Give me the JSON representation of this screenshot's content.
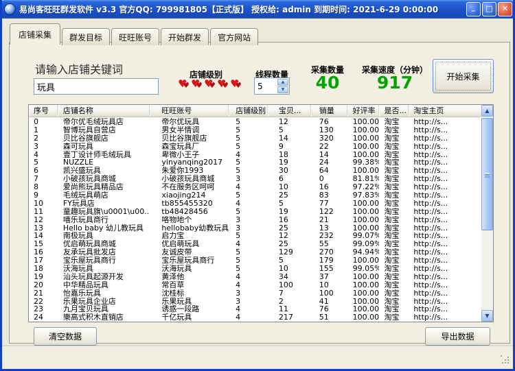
{
  "window": {
    "title": "易尚客旺旺群发软件  v3.3 官方QQ: 799981805【正式版】  授权给: admin   到期时间: 2021-6-29 0:00:00",
    "icons": {
      "minimize": "_",
      "maximize": "□",
      "close": "✕",
      "heart": "♥",
      "spin_up": "▲",
      "spin_down": "▼",
      "scroll_up": "▲",
      "scroll_down": "▼"
    }
  },
  "tabs": {
    "active": 0,
    "items": [
      "店铺采集",
      "群发目标",
      "旺旺账号",
      "开始群发",
      "官方网站"
    ]
  },
  "form": {
    "keyword_label": "请输入店铺关键词",
    "keyword_value": "玩具",
    "level_label": "店铺级别",
    "level_hearts": 5,
    "threads_label": "线程数量",
    "threads_value": "5",
    "count_label": "采集数量",
    "count_value": "40",
    "speed_label": "采集速度（分钟）",
    "speed_value": "917",
    "start_button": "开始采集"
  },
  "colors": {
    "value_green": "#00a400",
    "heart_red": "#dd1414",
    "titlebar_blue": "#1d55cd"
  },
  "table": {
    "columns": [
      "序号",
      "店铺名称",
      "旺旺账号",
      "店铺级别",
      "宝贝...",
      "销量",
      "好评率",
      "是否...",
      "淘宝主页"
    ],
    "rows": [
      [
        "0",
        "帝尔优毛绒玩具店",
        "帝尔优玩具",
        "5",
        "12",
        "76",
        "100.00%",
        "淘宝",
        "http://s..."
      ],
      [
        "1",
        "智博玩具自营店",
        "男女半情调",
        "5",
        "5",
        "130",
        "100.00%",
        "淘宝",
        "http://s..."
      ],
      [
        "2",
        "贝比谷旗舰店",
        "贝比谷旗舰店",
        "5",
        "14",
        "320",
        "100.00%",
        "淘宝",
        "http://s..."
      ],
      [
        "3",
        "森可玩具",
        "森宝玩具厂",
        "5",
        "9",
        "22",
        "100.00%",
        "淘宝",
        "http://s..."
      ],
      [
        "4",
        "壹丁设计师毛绒玩具",
        "卑微小王子",
        "4",
        "18",
        "14",
        "100.00%",
        "淘宝",
        "http://s..."
      ],
      [
        "5",
        "NUZZLE",
        "yinyanqing2017",
        "5",
        "19",
        "24",
        "99.38%",
        "淘宝",
        "http://s..."
      ],
      [
        "6",
        "凯兴盛玩具",
        "朱爱你1993",
        "5",
        "30",
        "64",
        "100.00%",
        "淘宝",
        "http://s..."
      ],
      [
        "7",
        "小破孩玩具商城",
        "小破孩玩具商城",
        "3",
        "6",
        "0",
        "81.81%",
        "淘宝",
        "http://s..."
      ],
      [
        "8",
        "爱尚熊玩具精品店",
        "不在服务区呵呵",
        "4",
        "10",
        "16",
        "97.22%",
        "淘宝",
        "http://s..."
      ],
      [
        "9",
        "毛绒玩具萌店",
        "xiaojing214",
        "5",
        "25",
        "83",
        "97.83%",
        "淘宝",
        "http://s..."
      ],
      [
        "10",
        "FY玩具店",
        "tb855455320",
        "4",
        "5",
        "77",
        "100.00%",
        "淘宝",
        "http://s..."
      ],
      [
        "11",
        "童趣玩具旗\\u0001\\u00...",
        "tb48428456",
        "5",
        "19",
        "122",
        "100.00%",
        "淘宝",
        "http://s..."
      ],
      [
        "12",
        "嘻乐玩具商行",
        "咯物地个",
        "3",
        "16",
        "21",
        "100.00%",
        "淘宝",
        "http://s..."
      ],
      [
        "13",
        "Hello baby 幼儿教玩具",
        "hellobaby幼教玩具",
        "3",
        "25",
        "13",
        "100.00%",
        "淘宝",
        "http://s..."
      ],
      [
        "14",
        "南极玩具",
        "启力宝",
        "5",
        "12",
        "232",
        "99.07%",
        "淘宝",
        "http://s..."
      ],
      [
        "15",
        "优启萌玩具商城",
        "优启萌玩具",
        "4",
        "25",
        "55",
        "99.09%",
        "淘宝",
        "http://s..."
      ],
      [
        "16",
        "友承玩具批发店",
        "友诚皮带",
        "5",
        "129",
        "270",
        "94.94%",
        "淘宝",
        "http://s..."
      ],
      [
        "17",
        "宝乐屋玩具商行",
        "宝乐屋玩具商行",
        "5",
        "5",
        "179",
        "100.00%",
        "淘宝",
        "http://s..."
      ],
      [
        "18",
        "沃海玩具",
        "沃海玩具",
        "5",
        "10",
        "155",
        "99.05%",
        "淘宝",
        "http://s..."
      ],
      [
        "19",
        "汕头玩具起源开发",
        "黄泽他",
        "4",
        "34",
        "37",
        "100.00%",
        "淘宝",
        "http://s..."
      ],
      [
        "20",
        "中华精品玩具",
        "常百草",
        "4",
        "100",
        "10",
        "100.00%",
        "淘宝",
        "http://s..."
      ],
      [
        "21",
        "怡嘉乐玩具",
        "沈桂标",
        "3",
        "7",
        "100",
        "100.00%",
        "淘宝",
        "http://s..."
      ],
      [
        "22",
        "乐果玩具企业店",
        "乐果玩具",
        "3",
        "2",
        "41",
        "100.00%",
        "淘宝",
        "http://s..."
      ],
      [
        "23",
        "九月宝贝玩具",
        "诱惑一段路",
        "4",
        "11",
        "76",
        "100.00%",
        "淘宝",
        "http://s..."
      ],
      [
        "24",
        "樂高式积木直销店",
        "千亿玩具",
        "4",
        "217",
        "51",
        "100.00%",
        "淘宝",
        "http://s..."
      ]
    ]
  },
  "footer": {
    "clear_label": "清空数据",
    "export_label": "导出数据"
  }
}
